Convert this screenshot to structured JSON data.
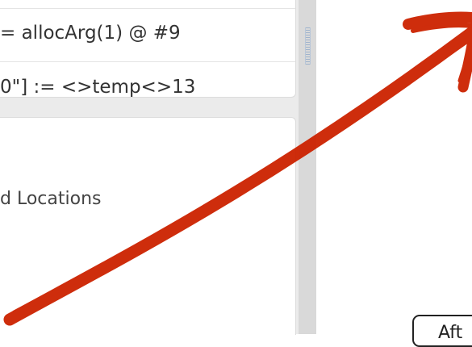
{
  "code_lines": [
    "= allocArg(1) @ #9",
    "0\"] := <>temp<>13"
  ],
  "section_label": "d Locations",
  "after_button_label": "Aft",
  "colors": {
    "annotation_arrow": "#cc2200",
    "pane_background": "#ebebeb",
    "splitter": "#d9d9d9"
  },
  "annotation": {
    "shape": "arrow",
    "direction": "up-right"
  }
}
